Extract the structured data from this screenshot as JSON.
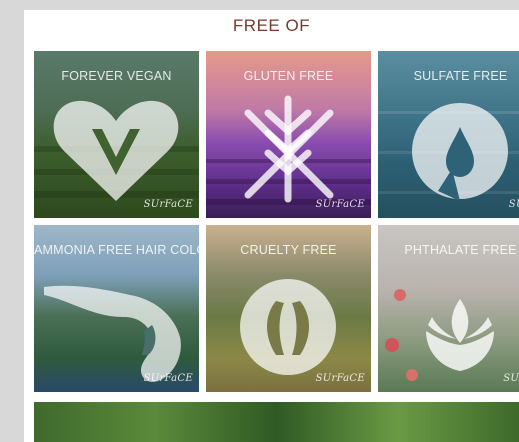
{
  "page": {
    "heading": "FREE OF",
    "heading_color": "#7a3a2e"
  },
  "tiles": [
    {
      "title": "FOREVER VEGAN",
      "brand": "SUrFaCE",
      "icon": "heart-v-icon"
    },
    {
      "title": "GLUTEN FREE",
      "brand": "SUrFaCE",
      "icon": "crossed-wheat-icon"
    },
    {
      "title": "SULFATE FREE",
      "brand": "SUrF",
      "icon": "water-drop-icon"
    },
    {
      "title": "AMMONIA FREE HAIR COLOR",
      "brand": "SUrFaCE",
      "icon": "woman-profile-icon"
    },
    {
      "title": "CRUELTY FREE",
      "brand": "SUrFaCE",
      "icon": "bunny-ears-icon"
    },
    {
      "title": "PHTHALATE FREE",
      "brand": "SUrFa",
      "icon": "lotus-flower-icon"
    }
  ]
}
